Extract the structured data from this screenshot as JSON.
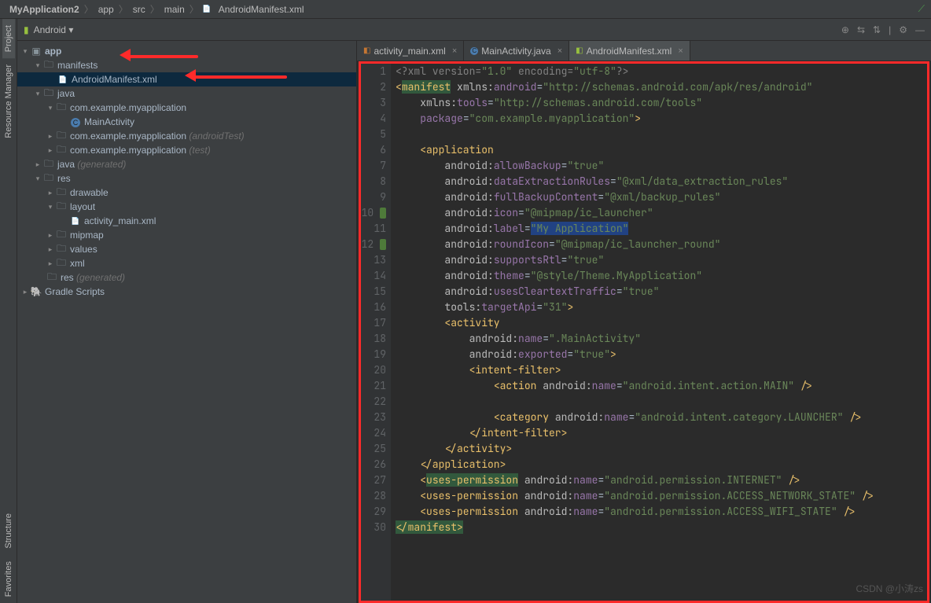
{
  "breadcrumbs": [
    "MyApplication2",
    "app",
    "src",
    "main",
    "AndroidManifest.xml"
  ],
  "sidebar_tabs": {
    "project": "Project",
    "resmgr": "Resource Manager",
    "structure": "Structure",
    "favorites": "Favorites"
  },
  "tree_header": {
    "android": "Android"
  },
  "tree": {
    "app": "app",
    "manifests": "manifests",
    "manifest_file": "AndroidManifest.xml",
    "java": "java",
    "pkg1": "com.example.myapplication",
    "main_activity": "MainActivity",
    "pkg2": "com.example.myapplication",
    "pkg2_suffix": "(androidTest)",
    "pkg3": "com.example.myapplication",
    "pkg3_suffix": "(test)",
    "java_gen": "java",
    "java_gen_suffix": "(generated)",
    "res": "res",
    "drawable": "drawable",
    "layout": "layout",
    "activity_main": "activity_main.xml",
    "mipmap": "mipmap",
    "values": "values",
    "xml": "xml",
    "res_gen": "res",
    "res_gen_suffix": "(generated)",
    "gradle": "Gradle Scripts"
  },
  "tabs": [
    {
      "label": "activity_main.xml",
      "kind": "xml"
    },
    {
      "label": "MainActivity.java",
      "kind": "java"
    },
    {
      "label": "AndroidManifest.xml",
      "kind": "manifest"
    }
  ],
  "active_tab": 2,
  "code_lines": [
    "<span class='c-comment'>&lt;?xml version=</span><span class='c-str'>\"1.0\"</span><span class='c-comment'> encoding=</span><span class='c-str'>\"utf-8\"</span><span class='c-comment'>?&gt;</span>",
    "<span class='c-tag'>&lt;</span><span class='c-tag c-hl2'>manifest</span> <span class='c-attr-ns'>xmlns:</span><span class='c-attr-name'>android</span>=<span class='c-str'>\"http://schemas.android.com/apk/res/android\"</span>",
    "    <span class='c-attr-ns'>xmlns:</span><span class='c-attr-name'>tools</span>=<span class='c-str'>\"http://schemas.android.com/tools\"</span>",
    "    <span class='c-attr-name'>package</span>=<span class='c-str'>\"com.example.myapplication\"</span><span class='c-tag'>&gt;</span>",
    "",
    "    <span class='c-tag'>&lt;application</span>",
    "        <span class='c-attr-ns'>android:</span><span class='c-attr-name'>allowBackup</span>=<span class='c-str'>\"true\"</span>",
    "        <span class='c-attr-ns'>android:</span><span class='c-attr-name'>dataExtractionRules</span>=<span class='c-str'>\"@xml/data_extraction_rules\"</span>",
    "        <span class='c-attr-ns'>android:</span><span class='c-attr-name'>fullBackupContent</span>=<span class='c-str'>\"@xml/backup_rules\"</span>",
    "        <span class='c-attr-ns'>android:</span><span class='c-attr-name'>icon</span>=<span class='c-str'>\"@mipmap/ic_launcher\"</span>",
    "        <span class='c-attr-ns'>android:</span><span class='c-attr-name'>label</span>=<span class='c-str c-hl'>\"My Application\"</span>",
    "        <span class='c-attr-ns'>android:</span><span class='c-attr-name'>roundIcon</span>=<span class='c-str'>\"@mipmap/ic_launcher_round\"</span>",
    "        <span class='c-attr-ns'>android:</span><span class='c-attr-name'>supportsRtl</span>=<span class='c-str'>\"true\"</span>",
    "        <span class='c-attr-ns'>android:</span><span class='c-attr-name'>theme</span>=<span class='c-str'>\"@style/Theme.MyApplication\"</span>",
    "        <span class='c-attr-ns'>android:</span><span class='c-attr-name'>usesCleartextTraffic</span>=<span class='c-str'>\"true\"</span>",
    "        <span class='c-attr-ns'>tools:</span><span class='c-attr-name'>targetApi</span>=<span class='c-str'>\"31\"</span><span class='c-tag'>&gt;</span>",
    "        <span class='c-tag'>&lt;activity</span>",
    "            <span class='c-attr-ns'>android:</span><span class='c-attr-name'>name</span>=<span class='c-str'>\".MainActivity\"</span>",
    "            <span class='c-attr-ns'>android:</span><span class='c-attr-name'>exported</span>=<span class='c-str'>\"true\"</span><span class='c-tag'>&gt;</span>",
    "            <span class='c-tag'>&lt;intent-filter&gt;</span>",
    "                <span class='c-tag'>&lt;action</span> <span class='c-attr-ns'>android:</span><span class='c-attr-name'>name</span>=<span class='c-str'>\"android.intent.action.MAIN\"</span> <span class='c-tag'>/&gt;</span>",
    "",
    "                <span class='c-tag'>&lt;category</span> <span class='c-attr-ns'>android:</span><span class='c-attr-name'>name</span>=<span class='c-str'>\"android.intent.category.LAUNCHER\"</span> <span class='c-tag'>/&gt;</span>",
    "            <span class='c-tag'>&lt;/intent-filter&gt;</span>",
    "        <span class='c-tag'>&lt;/activity&gt;</span>",
    "    <span class='c-tag'>&lt;/application&gt;</span>",
    "    <span class='c-tag'>&lt;</span><span class='c-tag c-hl2'>uses-permission</span> <span class='c-attr-ns'>android:</span><span class='c-attr-name'>name</span>=<span class='c-str'>\"android.permission.INTERNET\"</span> <span class='c-tag'>/&gt;</span>",
    "    <span class='c-tag'>&lt;uses-permission</span> <span class='c-attr-ns'>android:</span><span class='c-attr-name'>name</span>=<span class='c-str'>\"android.permission.ACCESS_NETWORK_STATE\"</span> <span class='c-tag'>/&gt;</span>",
    "    <span class='c-tag'>&lt;uses-permission</span> <span class='c-attr-ns'>android:</span><span class='c-attr-name'>name</span>=<span class='c-str'>\"android.permission.ACCESS_WIFI_STATE\"</span> <span class='c-tag'>/&gt;</span>",
    "<span class='c-tag c-hl2'>&lt;/manifest&gt;</span>"
  ],
  "watermark": "CSDN @小涛zs"
}
